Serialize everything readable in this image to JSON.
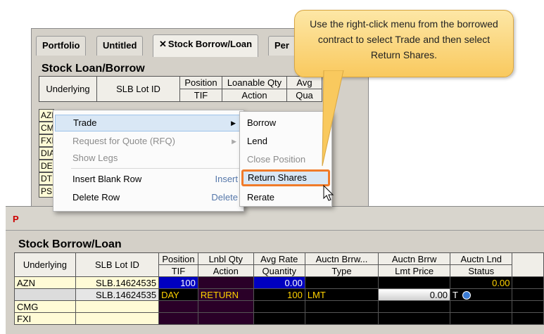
{
  "top_window": {
    "tabs": [
      "Portfolio",
      "Untitled",
      "Stock Borrow/Loan",
      "Per"
    ],
    "panel_title": "Stock Loan/Borrow",
    "headers": {
      "underlying": "Underlying",
      "slb_lot_id": "SLB Lot ID",
      "position": "Position",
      "tif": "TIF",
      "loanable_qty": "Loanable Qty",
      "action": "Action",
      "avg": "Avg",
      "qua": "Qua"
    },
    "row_underlyings": [
      "AZN",
      "CM",
      "FXI",
      "DIA",
      "DEC",
      "DT",
      "PSI"
    ]
  },
  "context_menu": {
    "items": [
      {
        "label": "Trade",
        "enabled": true,
        "submenu": true,
        "highlighted": true
      },
      {
        "label": "Request for Quote (RFQ)",
        "enabled": false,
        "submenu": true
      },
      {
        "label": "Show Legs",
        "enabled": false
      },
      {
        "label": "Insert Blank Row",
        "shortcut": "Insert",
        "enabled": true
      },
      {
        "label": "Delete Row",
        "shortcut": "Delete",
        "enabled": true
      }
    ]
  },
  "submenu": {
    "items": [
      {
        "label": "Borrow",
        "enabled": true
      },
      {
        "label": "Lend",
        "enabled": true
      },
      {
        "label": "Close Position",
        "enabled": false
      },
      {
        "label": "Return Shares",
        "enabled": true,
        "emphasized": true
      },
      {
        "label": "Rerate",
        "enabled": true
      }
    ]
  },
  "callout": {
    "text": "Use the right-click menu from the borrowed contract to select Trade and then select Return Shares."
  },
  "bottom_window": {
    "panel_title": "Stock Borrow/Loan",
    "headers_row1": [
      "Underlying",
      "SLB Lot ID",
      "Position",
      "Lnbl Qty",
      "Avg Rate",
      "Auctn Brrw...",
      "Auctn Brrw",
      "Auctn Lnd"
    ],
    "headers_row2": [
      "TIF",
      "Action",
      "Quantity",
      "Type",
      "Lmt Price",
      "Status"
    ],
    "rows": [
      {
        "underlying": "AZN",
        "lot_id": "SLB.14624535",
        "position": "100",
        "lnbl_qty": "",
        "avg_rate": "0.00",
        "auctn_brrw_type": "",
        "auctn_brrw_price": "",
        "auctn_lnd": "0.00"
      },
      {
        "underlying": "",
        "lot_id": "SLB.14624535",
        "tif": "DAY",
        "action": "RETURN",
        "quantity": "100",
        "type": "LMT",
        "lmt_price": "0.00",
        "status": "T"
      },
      {
        "underlying": "CMG",
        "lot_id": "",
        "position": "",
        "lnbl_qty": "",
        "avg_rate": "",
        "auctn_brrw_type": "",
        "auctn_brrw_price": "",
        "auctn_lnd": ""
      },
      {
        "underlying": "FXI",
        "lot_id": "",
        "position": "",
        "lnbl_qty": "",
        "avg_rate": "",
        "auctn_brrw_type": "",
        "auctn_brrw_price": "",
        "auctn_lnd": ""
      }
    ]
  },
  "colors": {
    "accent_orange": "#f07b2a",
    "callout_fill": "#f9c95e",
    "position_blue": "#0000c0",
    "order_yellow": "#ffd200"
  }
}
